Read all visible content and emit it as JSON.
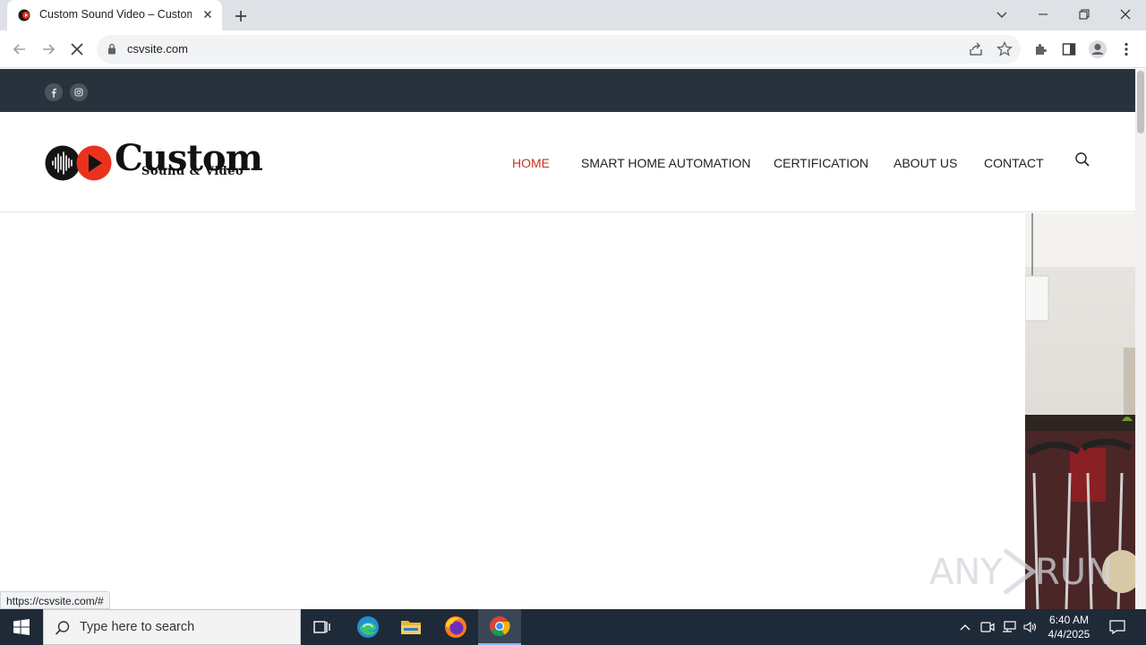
{
  "browser": {
    "tab_title": "Custom Sound Video – Custom",
    "url": "csvsite.com",
    "status_url": "https://csvsite.com/#"
  },
  "site": {
    "logo_word": "Custom",
    "logo_sub": "Sound & Video",
    "nav": [
      {
        "label": "HOME",
        "active": true
      },
      {
        "label": "SMART HOME AUTOMATION",
        "active": false
      },
      {
        "label": "CERTIFICATION",
        "active": false
      },
      {
        "label": "ABOUT US",
        "active": false
      },
      {
        "label": "CONTACT",
        "active": false
      }
    ],
    "social_icons": [
      "facebook-icon",
      "instagram-icon"
    ],
    "accent_color": "#c8321e",
    "topbar_color": "#28323c"
  },
  "watermark": {
    "left": "ANY",
    "right": "RUN"
  },
  "taskbar": {
    "search_placeholder": "Type here to search",
    "time": "6:40 AM",
    "date": "4/4/2025"
  }
}
